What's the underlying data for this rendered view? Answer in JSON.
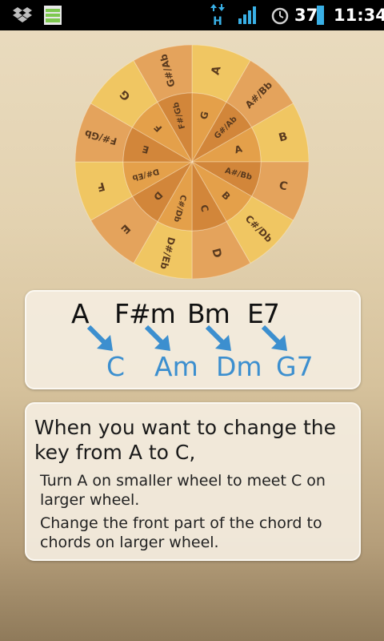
{
  "status_bar": {
    "battery_level": "37",
    "time": "11:34",
    "network_type": "H",
    "left_icons": [
      "dropbox-icon",
      "sd-card-icon"
    ],
    "right_icons": [
      "data-transfer-icon",
      "signal-icon",
      "alarm-icon",
      "battery-icon"
    ]
  },
  "wheel": {
    "outer_keys": [
      "A",
      "A#/Bb",
      "B",
      "C",
      "C#/Db",
      "D",
      "D#/Eb",
      "E",
      "F",
      "F#/Gb",
      "G",
      "G#/Ab"
    ],
    "inner_keys": [
      "G",
      "G#/Ab",
      "A",
      "A#/Bb",
      "B",
      "C",
      "C#/Db",
      "D",
      "D#/Eb",
      "E",
      "F",
      "F#/Gb"
    ],
    "colors": {
      "outer_light": "#f0c662",
      "outer_dark": "#e4a35c",
      "inner_light": "#e4a04a",
      "inner_dark": "#d2863a"
    }
  },
  "chord_example": {
    "from": [
      "A",
      "F#m",
      "Bm",
      "E7"
    ],
    "to": [
      "C",
      "Am",
      "Dm",
      "G7"
    ],
    "arrow_color": "#3c8fcf"
  },
  "info": {
    "title": "When you want to change the key from A to C,",
    "line1": "Turn A on smaller wheel to meet C on larger wheel.",
    "line2": "Change the front part of the chord to chords on larger wheel."
  }
}
